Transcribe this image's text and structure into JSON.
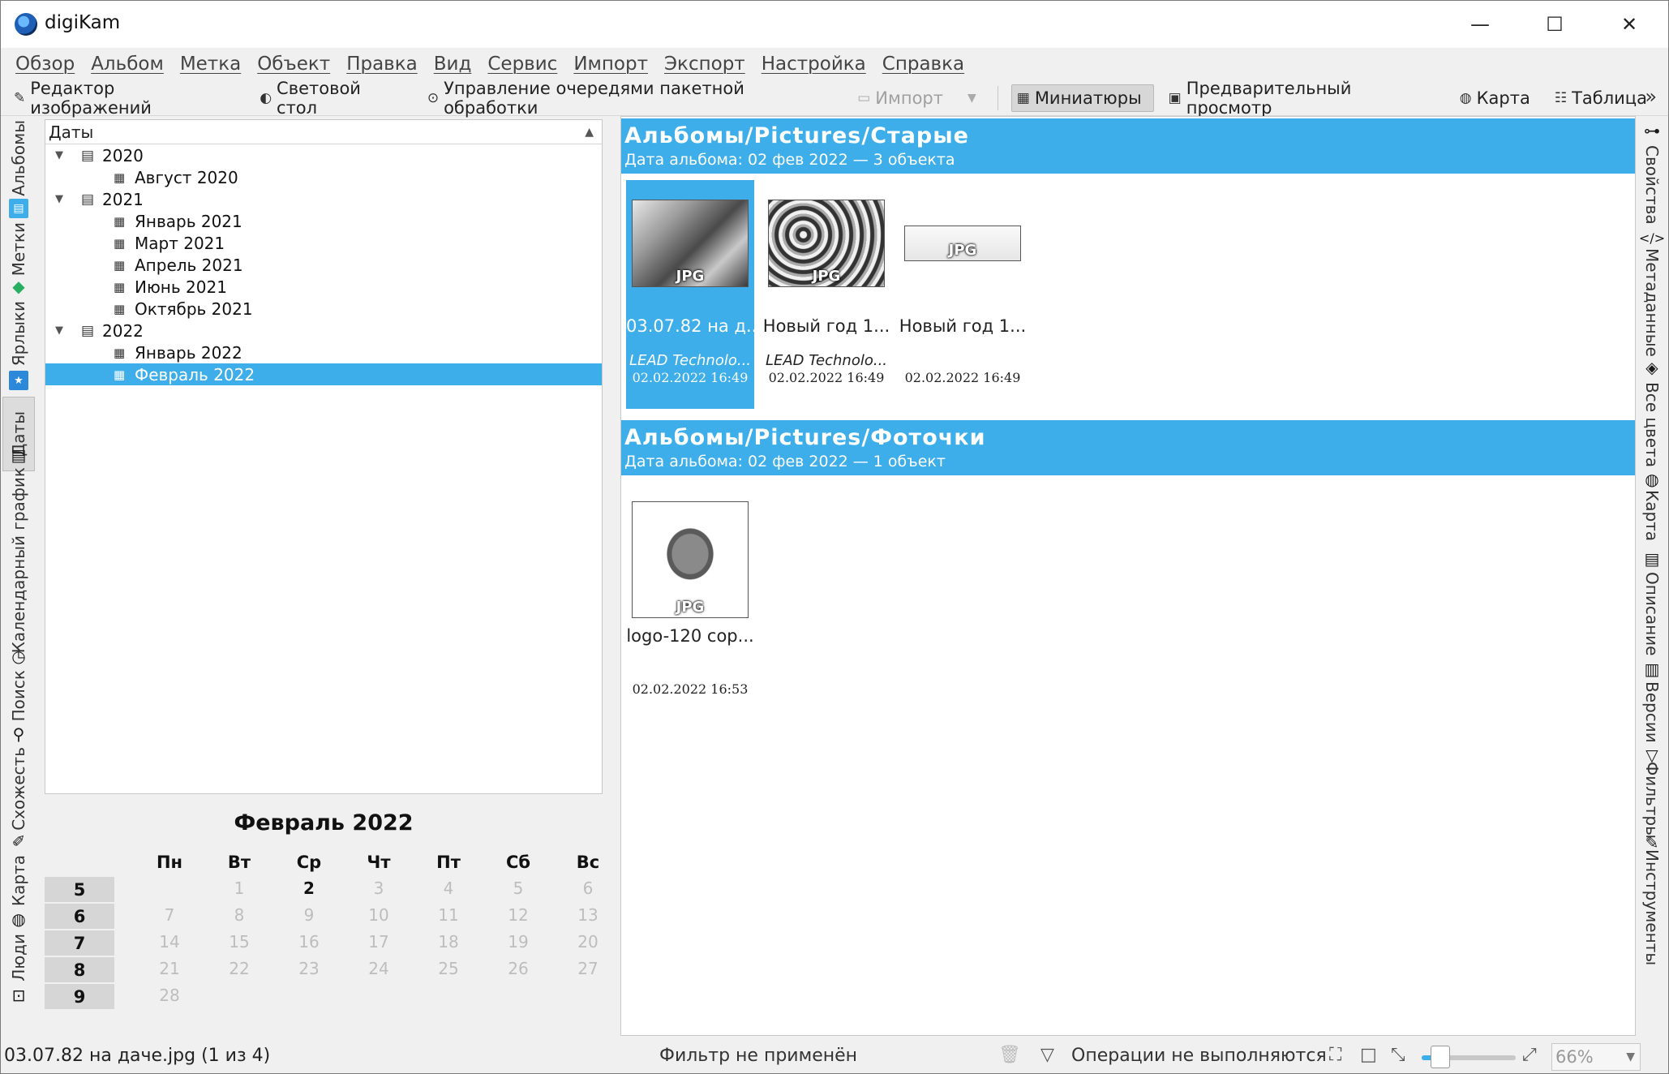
{
  "window": {
    "title": "digiKam",
    "minimize": "—",
    "maximize": "☐",
    "close": "✕"
  },
  "menu": [
    "Обзор",
    "Альбом",
    "Метка",
    "Объект",
    "Правка",
    "Вид",
    "Сервис",
    "Импорт",
    "Экспорт",
    "Настройка",
    "Справка"
  ],
  "toolbar": {
    "image_editor": "Редактор изображений",
    "light_table": "Световой стол",
    "batch_queue": "Управление очередями пакетной обработки",
    "import": "Импорт",
    "thumbnails": "Миниатюры",
    "preview": "Предварительный просмотр",
    "map": "Карта",
    "table": "Таблица",
    "more": "»"
  },
  "left_tabs": [
    "Альбомы",
    "Метки",
    "Ярлыки",
    "Даты",
    "Календарный график",
    "Поиск",
    "Схожесть",
    "Карта",
    "Люди"
  ],
  "right_tabs": [
    "Свойства",
    "Метаданные",
    "Все цвета",
    "Карта",
    "Описание",
    "Версии",
    "Фильтры",
    "Инструменты"
  ],
  "tree": {
    "header": "Даты",
    "rows": [
      {
        "label": "2020",
        "level": 0,
        "kind": "year"
      },
      {
        "label": "Август 2020",
        "level": 1,
        "kind": "month"
      },
      {
        "label": "2021",
        "level": 0,
        "kind": "year"
      },
      {
        "label": "Январь 2021",
        "level": 1,
        "kind": "month"
      },
      {
        "label": "Март 2021",
        "level": 1,
        "kind": "month"
      },
      {
        "label": "Апрель 2021",
        "level": 1,
        "kind": "month"
      },
      {
        "label": "Июнь 2021",
        "level": 1,
        "kind": "month"
      },
      {
        "label": "Октябрь 2021",
        "level": 1,
        "kind": "month"
      },
      {
        "label": "2022",
        "level": 0,
        "kind": "year"
      },
      {
        "label": "Январь 2022",
        "level": 1,
        "kind": "month"
      },
      {
        "label": "Февраль 2022",
        "level": 1,
        "kind": "month",
        "selected": true
      }
    ]
  },
  "calendar": {
    "title": "Февраль 2022",
    "days": [
      "Пн",
      "Вт",
      "Ср",
      "Чт",
      "Пт",
      "Сб",
      "Вс"
    ],
    "weeks": [
      "5",
      "6",
      "7",
      "8",
      "9"
    ],
    "dates": [
      [
        "",
        "1",
        "2",
        "3",
        "4",
        "5",
        "6"
      ],
      [
        "7",
        "8",
        "9",
        "10",
        "11",
        "12",
        "13"
      ],
      [
        "14",
        "15",
        "16",
        "17",
        "18",
        "19",
        "20"
      ],
      [
        "21",
        "22",
        "23",
        "24",
        "25",
        "26",
        "27"
      ],
      [
        "28",
        "",
        "",
        "",
        "",
        "",
        ""
      ]
    ],
    "dates_with_items": [
      "2"
    ]
  },
  "groups": [
    {
      "title": "Альбомы/Pictures/Старые",
      "subtitle": "Дата альбома: 02 фев 2022 — 3 объекта",
      "items": [
        {
          "name": "03.07.82 на д...",
          "maker": "LEAD Technolo...",
          "date": "02.02.2022 16:49",
          "badge": "JPG",
          "selected": true
        },
        {
          "name": "Новый год 1...",
          "maker": "LEAD Technolo...",
          "date": "02.02.2022 16:49",
          "badge": "JPG"
        },
        {
          "name": "Новый год 1...",
          "maker": "",
          "date": "02.02.2022 16:49",
          "badge": "JPG"
        }
      ]
    },
    {
      "title": "Альбомы/Pictures/Фоточки",
      "subtitle": "Дата альбома: 02 фев 2022 — 1 объект",
      "items": [
        {
          "name": "logo-120 cop...",
          "maker": "",
          "date": "02.02.2022 16:53",
          "badge": "JPG"
        }
      ]
    }
  ],
  "status": {
    "current_file": "03.07.82 на даче.jpg (1 из 4)",
    "filter": "Фильтр не применён",
    "operations": "Операции не выполняются",
    "zoom": "66%",
    "zoom_level": 0.2
  },
  "colors": {
    "selection": "#3daee9",
    "group_header": "#3daee9"
  }
}
